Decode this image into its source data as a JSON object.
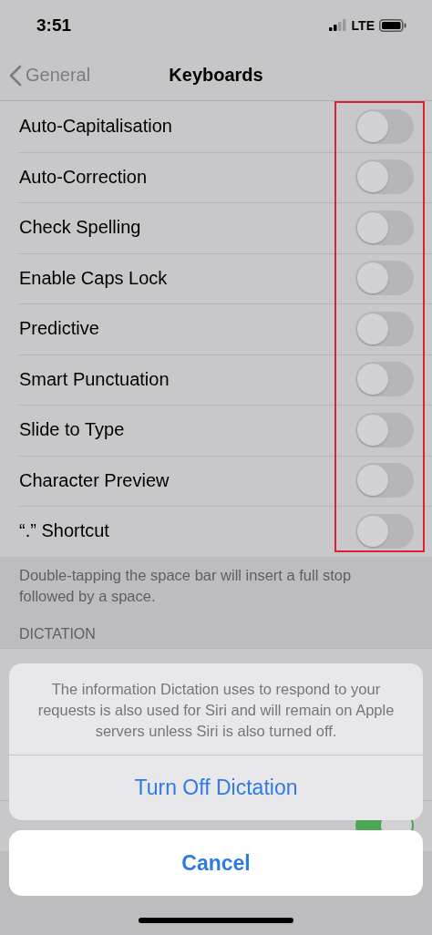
{
  "status_bar": {
    "time": "3:51",
    "network": "LTE"
  },
  "nav": {
    "back": "General",
    "title": "Keyboards"
  },
  "settings": [
    {
      "label": "Auto-Capitalisation",
      "on": false
    },
    {
      "label": "Auto-Correction",
      "on": false
    },
    {
      "label": "Check Spelling",
      "on": false
    },
    {
      "label": "Enable Caps Lock",
      "on": false
    },
    {
      "label": "Predictive",
      "on": false
    },
    {
      "label": "Smart Punctuation",
      "on": false
    },
    {
      "label": "Slide to Type",
      "on": false
    },
    {
      "label": "Character Preview",
      "on": false
    },
    {
      "label": "“.” Shortcut",
      "on": false
    }
  ],
  "settings_footer": "Double-tapping the space bar will insert a full stop followed by a space.",
  "dictation_header": "DICTATION",
  "dictation_rows": [
    {
      "on": true
    }
  ],
  "action_sheet": {
    "message": "The information Dictation uses to respond to your requests is also used for Siri and will remain on Apple servers unless Siri is also turned off.",
    "action": "Turn Off Dictation",
    "cancel": "Cancel"
  }
}
